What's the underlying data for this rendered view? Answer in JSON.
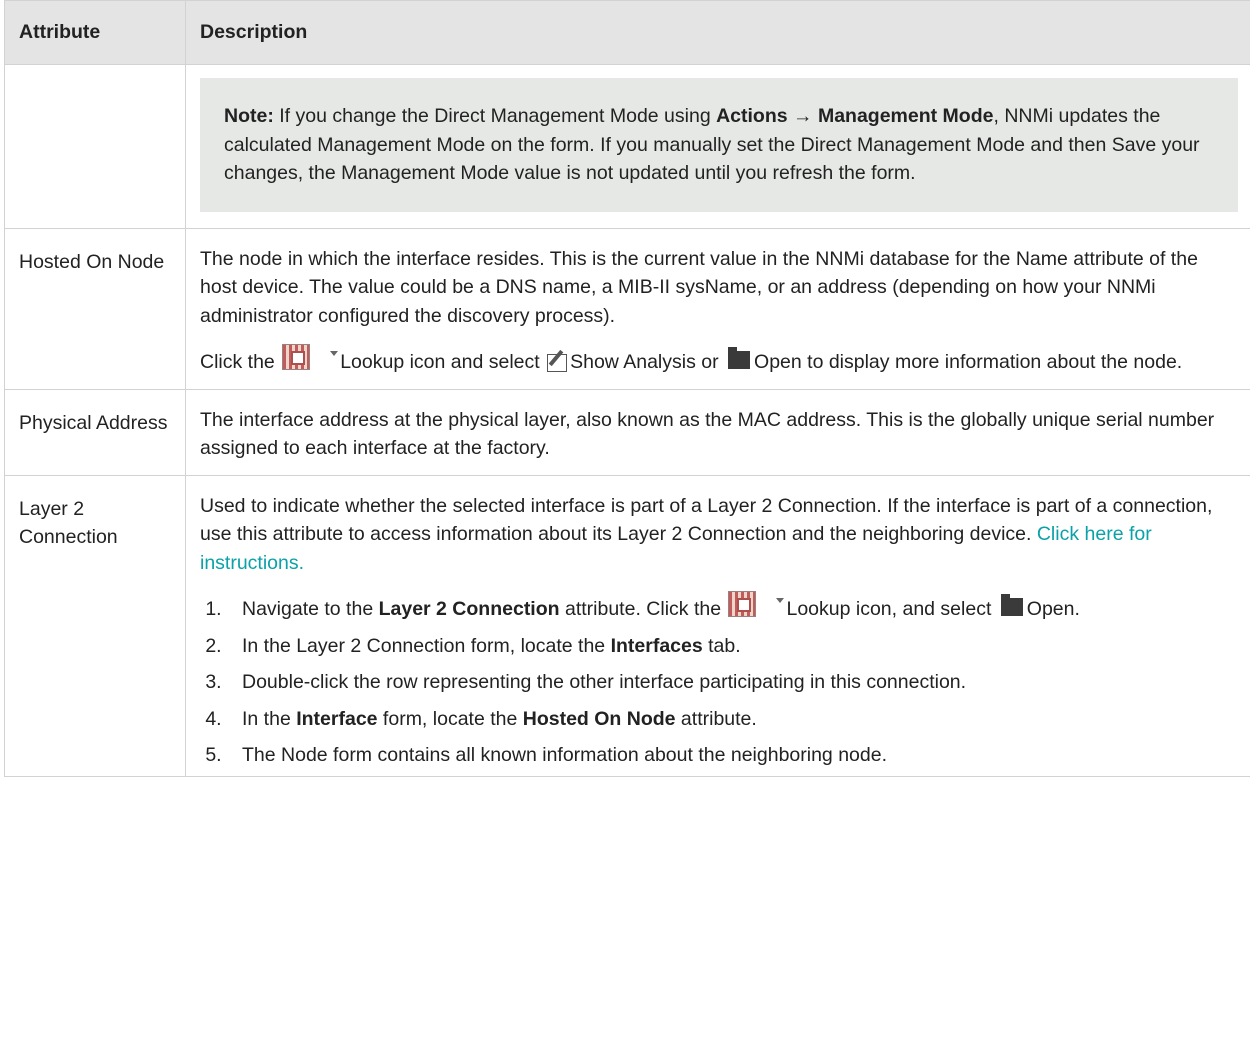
{
  "table": {
    "headers": {
      "attribute": "Attribute",
      "description": "Description"
    }
  },
  "note": {
    "label": "Note:",
    "text1": " If you change the Direct Management Mode using ",
    "actions": "Actions",
    "arrow": " → ",
    "management_mode": "Management Mode",
    "text2": ", NNMi updates the calculated Management Mode on the form. If you manually set the Direct Management Mode and then Save your changes, the Management Mode value is not updated until you refresh the form."
  },
  "rows": [
    {
      "attribute": "Hosted On Node",
      "para1": "The node in which the interface resides. This is the current value in the NNMi database for the Name attribute of the host device. The value could be a DNS name, a MIB-II sysName, or an address (depending on how your NNMi administrator configured the discovery process).",
      "para2": {
        "t1": "Click the",
        "t2": "Lookup icon and select",
        "t3": "Show Analysis or",
        "t4": "Open to display more information about the node."
      }
    },
    {
      "attribute": "Physical Address",
      "para1": "The interface address at the physical layer, also known as the MAC address. This is the globally unique serial number assigned to each interface at the factory."
    },
    {
      "attribute": "Layer 2 Connection",
      "para1": "Used to indicate whether the selected interface is part of a Layer 2 Connection. If the interface is part of a connection, use this attribute to access information about its Layer 2 Connection and the neighboring device. ",
      "link": "Click here for instructions.",
      "steps": [
        {
          "t1": "Navigate to the ",
          "b1": "Layer 2 Connection",
          "t2": " attribute. Click the",
          "t3": "Lookup icon, and select",
          "t4": "Open."
        },
        {
          "t1": "In the Layer 2 Connection form, locate the ",
          "b1": "Interfaces",
          "t2": " tab."
        },
        {
          "t1": "Double-click the row representing the other interface participating in this connection."
        },
        {
          "t1": "In the ",
          "b1": "Interface",
          "t2": " form, locate the ",
          "b2": "Hosted On Node",
          "t3": " attribute."
        },
        {
          "t1": "The Node form contains all known information about the neighboring node."
        }
      ]
    }
  ],
  "icons": {
    "lookup": "lookup-icon",
    "show_analysis": "edit-icon",
    "open": "folder-icon"
  }
}
